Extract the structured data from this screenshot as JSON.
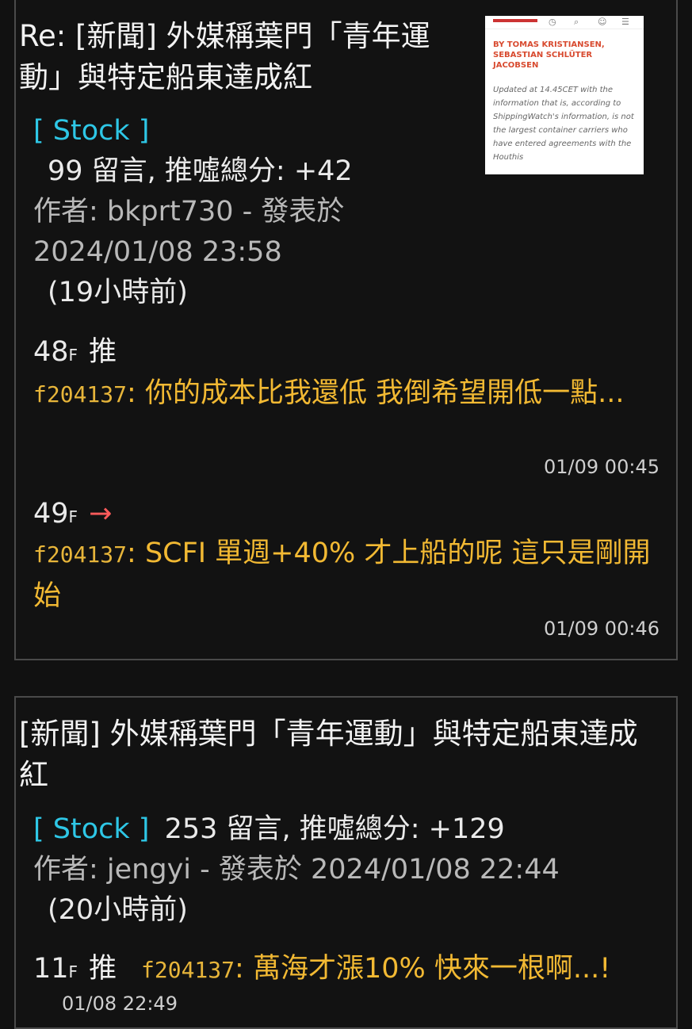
{
  "post1": {
    "title": "Re: [新聞] 外媒稱葉門「青年運動」與特定船東達成紅",
    "board": "[ Stock ]",
    "counts": "99 留言, 推噓總分: +42",
    "author": "作者: bkprt730 - 發表於",
    "date": "2024/01/08 23:58",
    "ago": "(19小時前)",
    "thumbnail": {
      "byline": "BY TOMAS KRISTIANSEN, SEBASTIAN SCHLÜTER JACOBSEN",
      "body": "Updated at 14.45CET with the information that is, according to ShippingWatch's information, is not the largest container carriers who have entered agreements with the Houthis"
    },
    "comments": [
      {
        "floor": "48",
        "floor_suffix": "F",
        "tag": "推",
        "user": "f204137",
        "sep": ": ",
        "text": "你的成本比我還低 我倒希望開低一點...",
        "time": "01/09 00:45"
      },
      {
        "floor": "49",
        "floor_suffix": "F",
        "tag": "→",
        "user": "f204137",
        "sep": ": ",
        "text": "SCFI 單週+40% 才上船的呢 這只是剛開始",
        "time": "01/09 00:46"
      }
    ]
  },
  "post2": {
    "title": "[新聞] 外媒稱葉門「青年運動」與特定船東達成紅",
    "board": "[ Stock ]",
    "counts": "253 留言, 推噓總分: +129",
    "author": "作者: jengyi - 發表於 2024/01/08 22:44",
    "ago": "(20小時前)",
    "comments": [
      {
        "floor": "11",
        "floor_suffix": "F",
        "tag": "推",
        "user": "f204137",
        "sep": ": ",
        "text": "萬海才漲10% 快來一根啊...!",
        "time": "01/08 22:49"
      }
    ]
  },
  "colors": {
    "background": "#111111",
    "board_tag": "#2ec7e6",
    "comment_text": "#f2b933",
    "arrow_tag": "#ff5b5b",
    "border": "#4a4a4a"
  }
}
